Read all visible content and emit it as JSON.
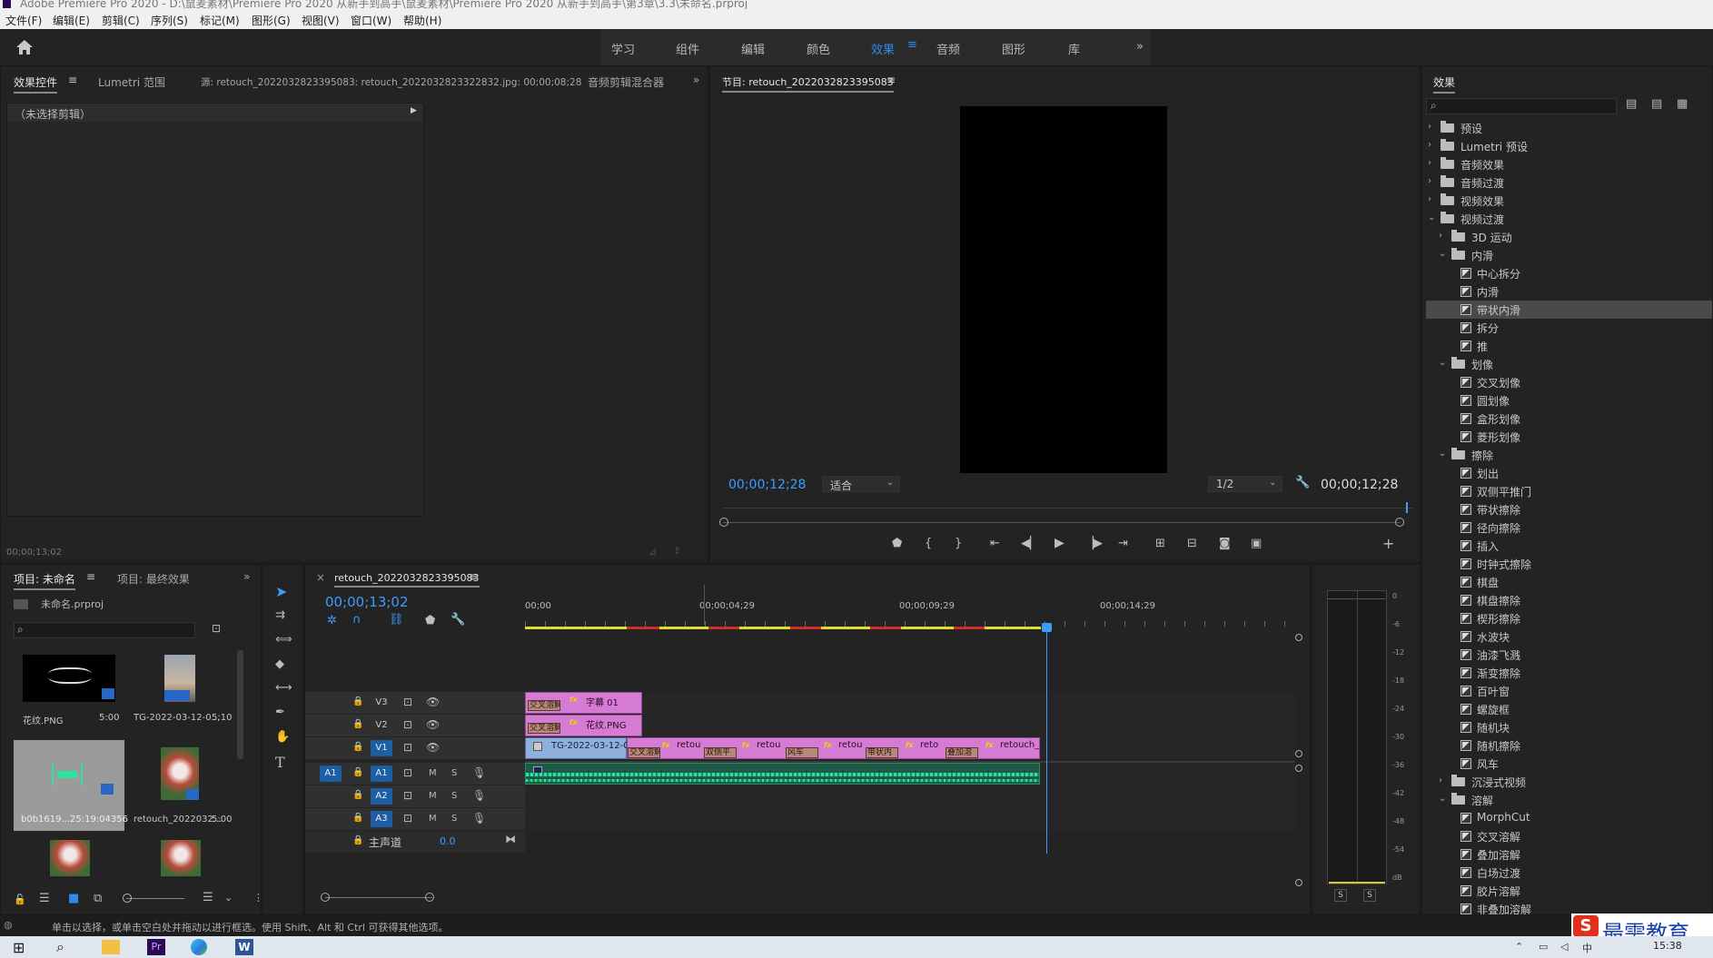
{
  "window": {
    "title": "Adobe Premiere Pro 2020 - D:\\鼠麦素材\\Premiere Pro 2020 从新手到高手\\鼠麦素材\\Premiere Pro 2020 从新手到高手\\第3章\\3.3\\未命名.prproj"
  },
  "menu": [
    "文件(F)",
    "编辑(E)",
    "剪辑(C)",
    "序列(S)",
    "标记(M)",
    "图形(G)",
    "视图(V)",
    "窗口(W)",
    "帮助(H)"
  ],
  "workspaces": {
    "tabs": [
      "学习",
      "组件",
      "编辑",
      "颜色",
      "效果",
      "音频",
      "图形",
      "库"
    ],
    "active": "效果",
    "more": "»"
  },
  "source_panel": {
    "tabs": [
      "效果控件",
      "Lumetri 范围",
      "源: retouch_2022032823395083: retouch_2022032823322832.jpg: 00;00;08;28",
      "音频剪辑混合器"
    ],
    "no_clip": "（未选择剪辑）",
    "timecode": "00;00;13;02"
  },
  "program": {
    "title": "节目: retouch_2022032823395083",
    "timecode_left": "00;00;12;28",
    "fit": "适合",
    "resolution": "1/2",
    "timecode_right": "00;00;12;28"
  },
  "effects_panel": {
    "title": "效果",
    "tree": [
      {
        "label": "预设",
        "level": 0,
        "type": "folder",
        "state": "closed"
      },
      {
        "label": "Lumetri 预设",
        "level": 0,
        "type": "folder",
        "state": "closed"
      },
      {
        "label": "音频效果",
        "level": 0,
        "type": "folder",
        "state": "closed"
      },
      {
        "label": "音频过渡",
        "level": 0,
        "type": "folder",
        "state": "closed"
      },
      {
        "label": "视频效果",
        "level": 0,
        "type": "folder",
        "state": "closed"
      },
      {
        "label": "视频过渡",
        "level": 0,
        "type": "folder",
        "state": "open"
      },
      {
        "label": "3D 运动",
        "level": 1,
        "type": "folder",
        "state": "closed"
      },
      {
        "label": "内滑",
        "level": 1,
        "type": "folder",
        "state": "open"
      },
      {
        "label": "中心拆分",
        "level": 2,
        "type": "fx"
      },
      {
        "label": "内滑",
        "level": 2,
        "type": "fx"
      },
      {
        "label": "带状内滑",
        "level": 2,
        "type": "fx",
        "selected": true
      },
      {
        "label": "拆分",
        "level": 2,
        "type": "fx"
      },
      {
        "label": "推",
        "level": 2,
        "type": "fx"
      },
      {
        "label": "划像",
        "level": 1,
        "type": "folder",
        "state": "open"
      },
      {
        "label": "交叉划像",
        "level": 2,
        "type": "fx"
      },
      {
        "label": "圆划像",
        "level": 2,
        "type": "fx"
      },
      {
        "label": "盒形划像",
        "level": 2,
        "type": "fx"
      },
      {
        "label": "菱形划像",
        "level": 2,
        "type": "fx"
      },
      {
        "label": "擦除",
        "level": 1,
        "type": "folder",
        "state": "open"
      },
      {
        "label": "划出",
        "level": 2,
        "type": "fx"
      },
      {
        "label": "双侧平推门",
        "level": 2,
        "type": "fx"
      },
      {
        "label": "带状擦除",
        "level": 2,
        "type": "fx"
      },
      {
        "label": "径向擦除",
        "level": 2,
        "type": "fx"
      },
      {
        "label": "插入",
        "level": 2,
        "type": "fx"
      },
      {
        "label": "时钟式擦除",
        "level": 2,
        "type": "fx"
      },
      {
        "label": "棋盘",
        "level": 2,
        "type": "fx"
      },
      {
        "label": "棋盘擦除",
        "level": 2,
        "type": "fx"
      },
      {
        "label": "楔形擦除",
        "level": 2,
        "type": "fx"
      },
      {
        "label": "水波块",
        "level": 2,
        "type": "fx"
      },
      {
        "label": "油漆飞溅",
        "level": 2,
        "type": "fx"
      },
      {
        "label": "渐变擦除",
        "level": 2,
        "type": "fx"
      },
      {
        "label": "百叶窗",
        "level": 2,
        "type": "fx"
      },
      {
        "label": "螺旋框",
        "level": 2,
        "type": "fx"
      },
      {
        "label": "随机块",
        "level": 2,
        "type": "fx"
      },
      {
        "label": "随机擦除",
        "level": 2,
        "type": "fx"
      },
      {
        "label": "风车",
        "level": 2,
        "type": "fx"
      },
      {
        "label": "沉浸式视频",
        "level": 1,
        "type": "folder",
        "state": "closed"
      },
      {
        "label": "溶解",
        "level": 1,
        "type": "folder",
        "state": "open"
      },
      {
        "label": "MorphCut",
        "level": 2,
        "type": "fx"
      },
      {
        "label": "交叉溶解",
        "level": 2,
        "type": "fx"
      },
      {
        "label": "叠加溶解",
        "level": 2,
        "type": "fx"
      },
      {
        "label": "白场过渡",
        "level": 2,
        "type": "fx"
      },
      {
        "label": "胶片溶解",
        "level": 2,
        "type": "fx"
      },
      {
        "label": "非叠加溶解",
        "level": 2,
        "type": "fx"
      }
    ]
  },
  "project": {
    "tabs": [
      "项目: 未命名",
      "项目: 最终效果"
    ],
    "file": "未命名.prproj",
    "items": [
      {
        "name": "花纹.PNG",
        "dur": "5:00"
      },
      {
        "name": "TG-2022-03-12-0...",
        "dur": "5;10"
      },
      {
        "name": "b0b1619...",
        "dur": "25:19:04356"
      },
      {
        "name": "retouch_2022032...",
        "dur": "5:00"
      }
    ]
  },
  "timeline": {
    "tab": "retouch_2022032823395083",
    "timecode": "00;00;13;02",
    "ruler": [
      "00;00",
      "00;00;04;29",
      "00;00;09;29",
      "00;00;14;29"
    ],
    "tracks_video": [
      "V3",
      "V2",
      "V1"
    ],
    "tracks_audio": [
      "A1",
      "A2",
      "A3"
    ],
    "source_patch": [
      "V1",
      "A1"
    ],
    "master": "主声道",
    "master_val": "0.0",
    "m_label": "M",
    "s_label": "S",
    "clips": {
      "v3": "字幕 01",
      "v2": "花纹.PNG",
      "v1": [
        "TG-2022-03-12-073",
        "retou",
        "retou",
        "retou",
        "reto",
        "retouch_"
      ],
      "v3_trans": "交叉溶解",
      "v2_trans": "交叉溶解",
      "v1_trans": [
        "交叉溶解",
        "双侧平",
        "风车",
        "带状内",
        "叠加溶"
      ]
    }
  },
  "meter": {
    "scale": [
      "0",
      "-6",
      "-12",
      "-18",
      "-24",
      "-30",
      "-36",
      "-42",
      "-48",
      "-54",
      "dB"
    ],
    "solo": [
      "S",
      "S"
    ]
  },
  "status": "单击以选择，或单击空白处并拖动以进行框选。使用 Shift、Alt 和 Ctrl 可获得其他选项。",
  "clock": "15:38",
  "watermark": "最需教育"
}
